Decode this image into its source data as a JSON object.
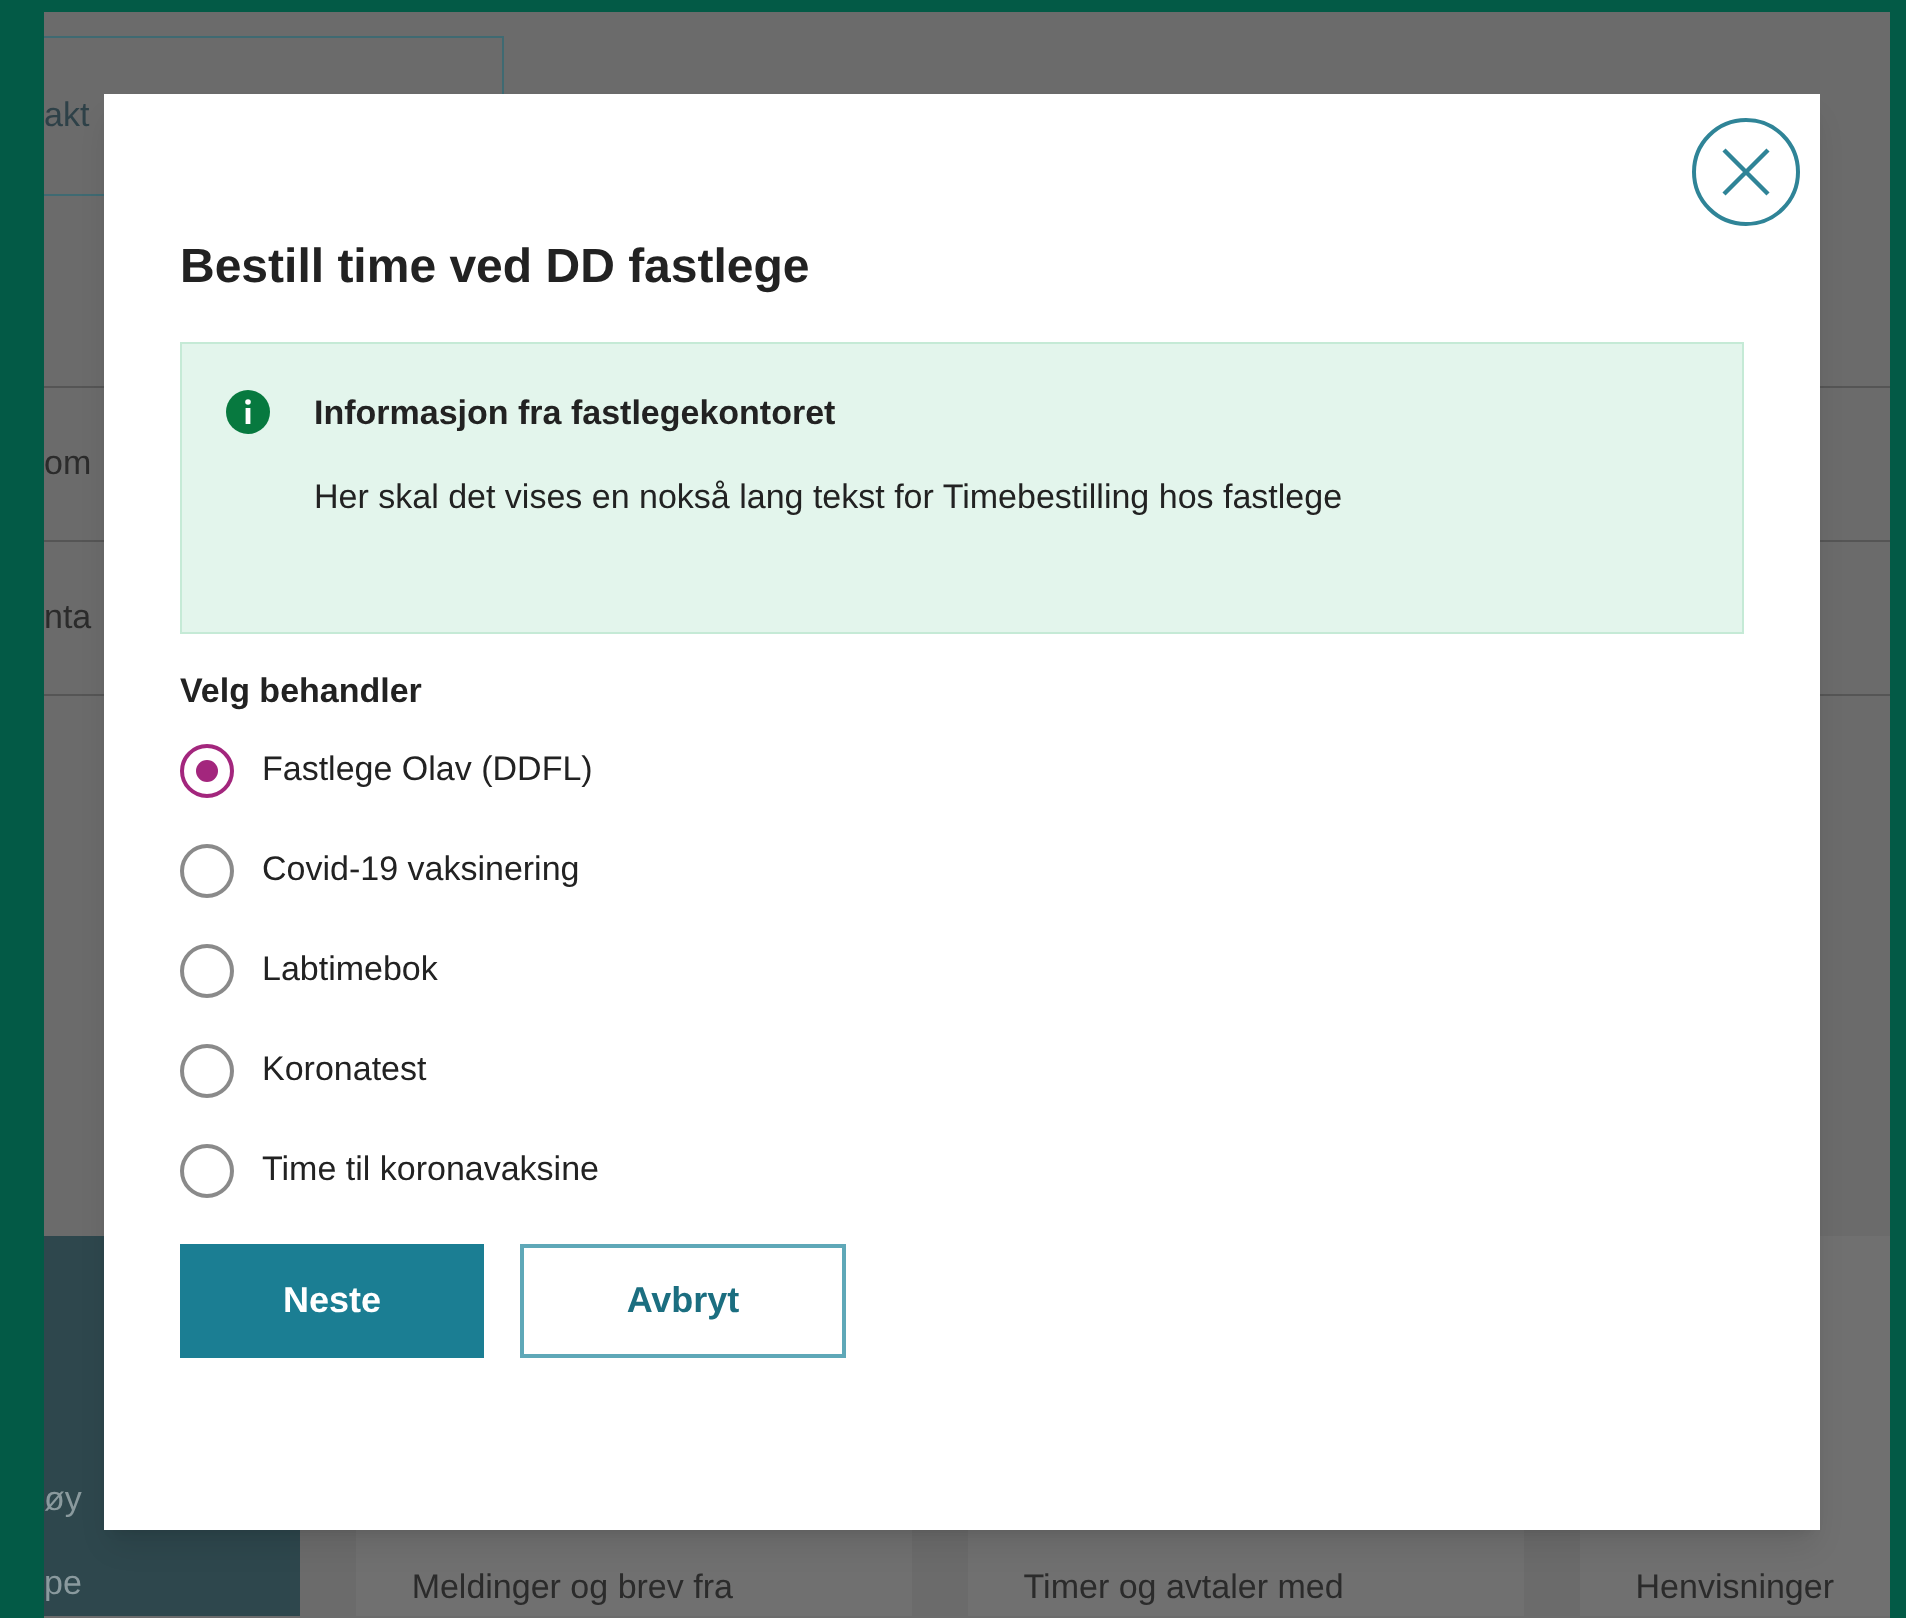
{
  "background": {
    "top_box": "akt",
    "rows": [
      "om",
      "nta"
    ],
    "side_panel": [
      "øy",
      "pe"
    ],
    "cards": [
      "Meldinger og brev fra",
      "Timer og avtaler med",
      "Henvisninger"
    ]
  },
  "dialog": {
    "title": "Bestill time ved DD fastlege",
    "info": {
      "heading": "Informasjon fra fastlegekontoret",
      "body": "Her skal det vises en nokså lang tekst for Timebestilling hos fastlege"
    },
    "group_label": "Velg behandler",
    "options": [
      {
        "label": "Fastlege Olav (DDFL)",
        "selected": true
      },
      {
        "label": "Covid-19 vaksinering",
        "selected": false
      },
      {
        "label": "Labtimebok",
        "selected": false
      },
      {
        "label": "Koronatest",
        "selected": false
      },
      {
        "label": "Time til koronavaksine",
        "selected": false
      }
    ],
    "buttons": [
      {
        "label": "Neste",
        "kind": "primary"
      },
      {
        "label": "Avbryt",
        "kind": "secondary"
      }
    ]
  }
}
